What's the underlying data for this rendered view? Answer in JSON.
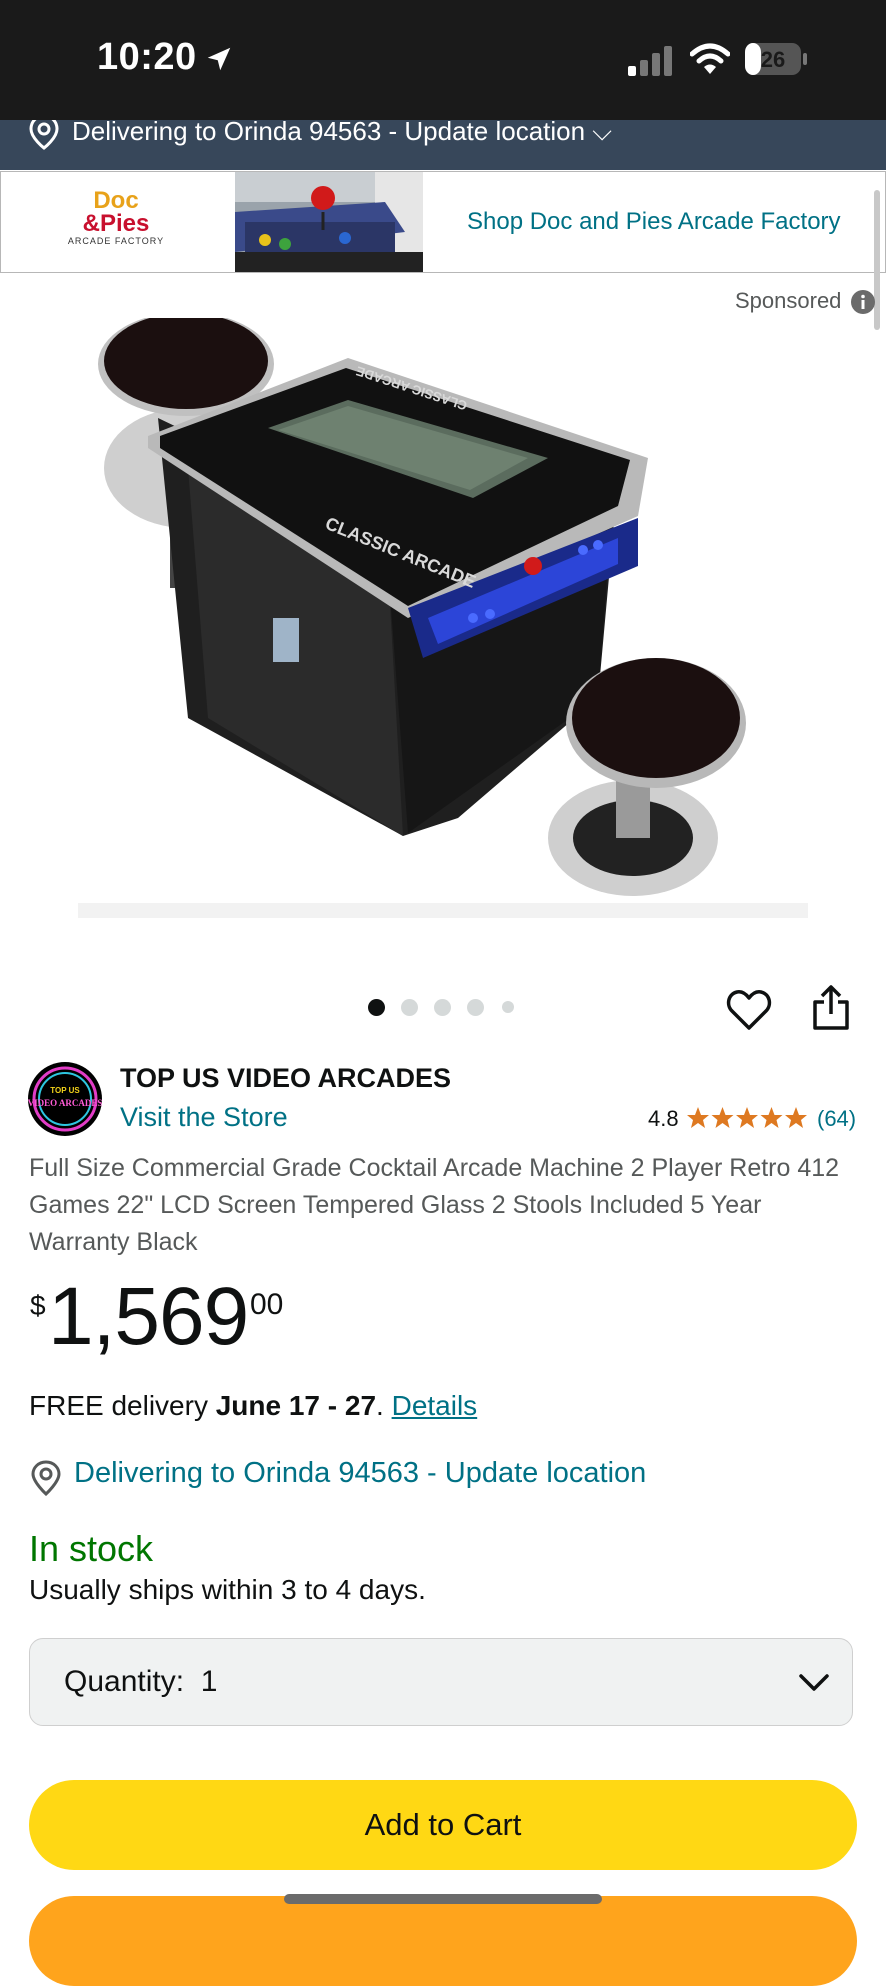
{
  "status_bar": {
    "time": "10:20",
    "battery": "26"
  },
  "top_delivery_bar": {
    "text": "Delivering to Orinda 94563 - Update location ⌵"
  },
  "sponsored_banner": {
    "logo_lines": [
      "Doc",
      "&Pies",
      "ARCADE FACTORY"
    ],
    "link_text": "Shop Doc and Pies Arcade Factory"
  },
  "sponsored_label": "Sponsored",
  "carousel": {
    "count": 5,
    "active_index": 0
  },
  "seller": {
    "logo_lines": [
      "TOP US",
      "VIDEO ARCADES"
    ],
    "name": "TOP US VIDEO ARCADES",
    "store_link": "Visit the Store"
  },
  "rating": {
    "value": "4.8",
    "stars": 4.8,
    "count": "(64)"
  },
  "product": {
    "title": "Full Size Commercial Grade Cocktail Arcade Machine 2 Player Retro 412 Games 22\" LCD Screen Tempered Glass 2 Stools Included 5 Year Warranty Black",
    "image_labels": [
      "CLASSIC ARCADE",
      "CLASSIC ARCADE"
    ]
  },
  "price": {
    "symbol": "$",
    "whole": "1,569",
    "fraction": "00"
  },
  "delivery": {
    "prefix": "FREE delivery ",
    "dates": "June 17 - 27",
    "sep": ". ",
    "details_link": "Details"
  },
  "delivery_location": "Delivering to Orinda 94563 - Update location",
  "availability": {
    "status": "In stock",
    "ships": "Usually ships within 3 to 4 days."
  },
  "quantity": {
    "label": "Quantity:",
    "value": "1"
  },
  "buttons": {
    "add_to_cart": "Add to Cart"
  },
  "colors": {
    "link": "#007185",
    "in_stock": "#007600",
    "add_to_cart": "#ffd814",
    "buy_now": "#ffa41c",
    "star": "#de7921",
    "delivery_bar": "#37475a"
  }
}
